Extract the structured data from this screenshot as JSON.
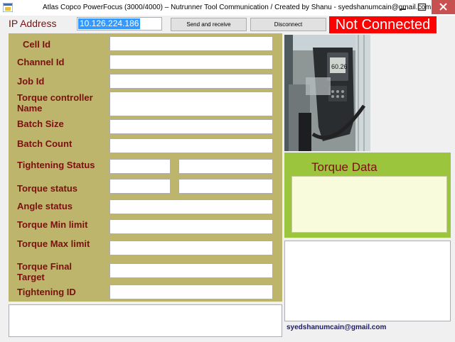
{
  "window": {
    "title": "Atlas Copco PowerFocus (3000/4000) – Nutrunner Tool Communication / Created by Shanu - syedshanumcain@gmail.com"
  },
  "header": {
    "ip_label": "IP Address",
    "ip_value": "10.126.224.186",
    "send_label": "Send and receive",
    "disconnect_label": "Disconnect",
    "status": "Not Connected"
  },
  "fields": {
    "cell_id": "Cell Id",
    "channel_id": "Channel Id",
    "job_id": "Job Id",
    "torque_controller_name": "Torque controller Name",
    "batch_size": "Batch Size",
    "batch_count": "Batch Count",
    "tightening_status": "Tightening Status",
    "torque_status": "Torque status",
    "angle_status": "Angle status",
    "torque_min_limit": "Torque Min limit",
    "torque_max_limit": "Torque Max limit",
    "torque_final_target": "Torque Final Target",
    "tightening_id": "Tightening ID"
  },
  "torque_panel": {
    "title": "Torque Data"
  },
  "photo": {
    "display_reading": "60.26"
  },
  "footer": {
    "email": "syedshanumcain@gmail.com"
  },
  "colors": {
    "panel": "#bdb56b",
    "label": "#7b1010",
    "torque_panel": "#9bc53d",
    "status_bg": "#ff0000"
  }
}
